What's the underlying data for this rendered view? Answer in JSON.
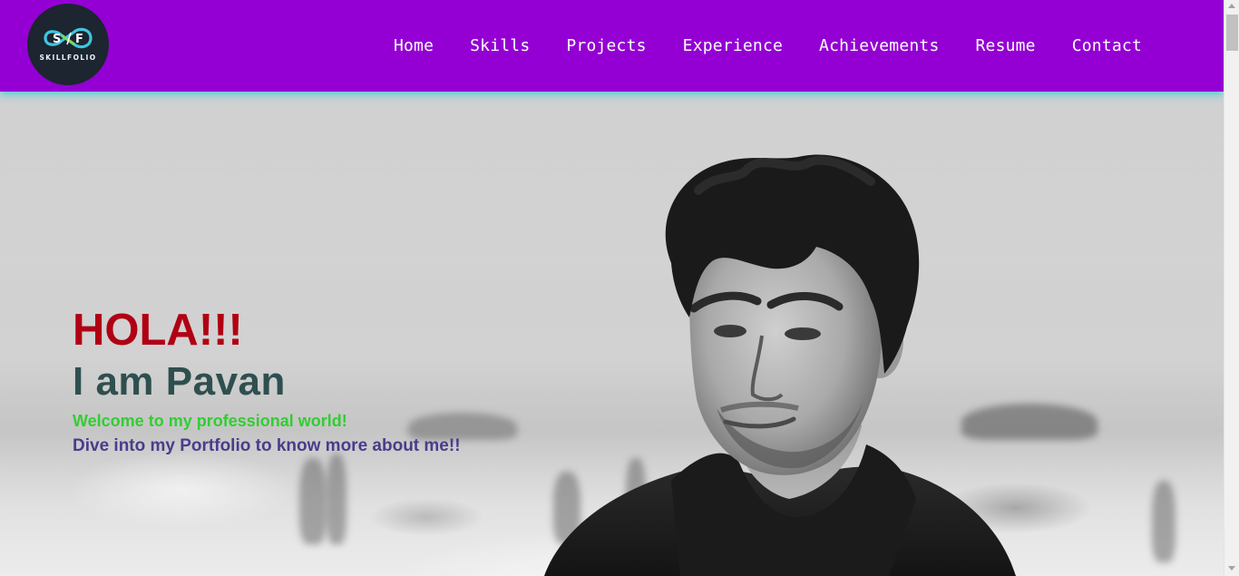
{
  "brand": {
    "logo_initials": "S/F",
    "logo_text": "SKILLFOLIO",
    "header_color": "#9400d3",
    "logo_bg": "#1c2530"
  },
  "nav": {
    "items": [
      {
        "label": "Home"
      },
      {
        "label": "Skills"
      },
      {
        "label": "Projects"
      },
      {
        "label": "Experience"
      },
      {
        "label": "Achievements"
      },
      {
        "label": "Resume"
      },
      {
        "label": "Contact"
      }
    ]
  },
  "hero": {
    "greeting": "HOLA!!!",
    "name_line": "I am Pavan",
    "welcome_line": "Welcome to my professional world!",
    "dive_line": "Dive into my Portfolio to know more about me!!",
    "colors": {
      "greeting": "#b00013",
      "name": "#2f4f4f",
      "welcome": "#32cd32",
      "dive": "#483d8b"
    },
    "image": "grayscale-portrait-photo"
  }
}
